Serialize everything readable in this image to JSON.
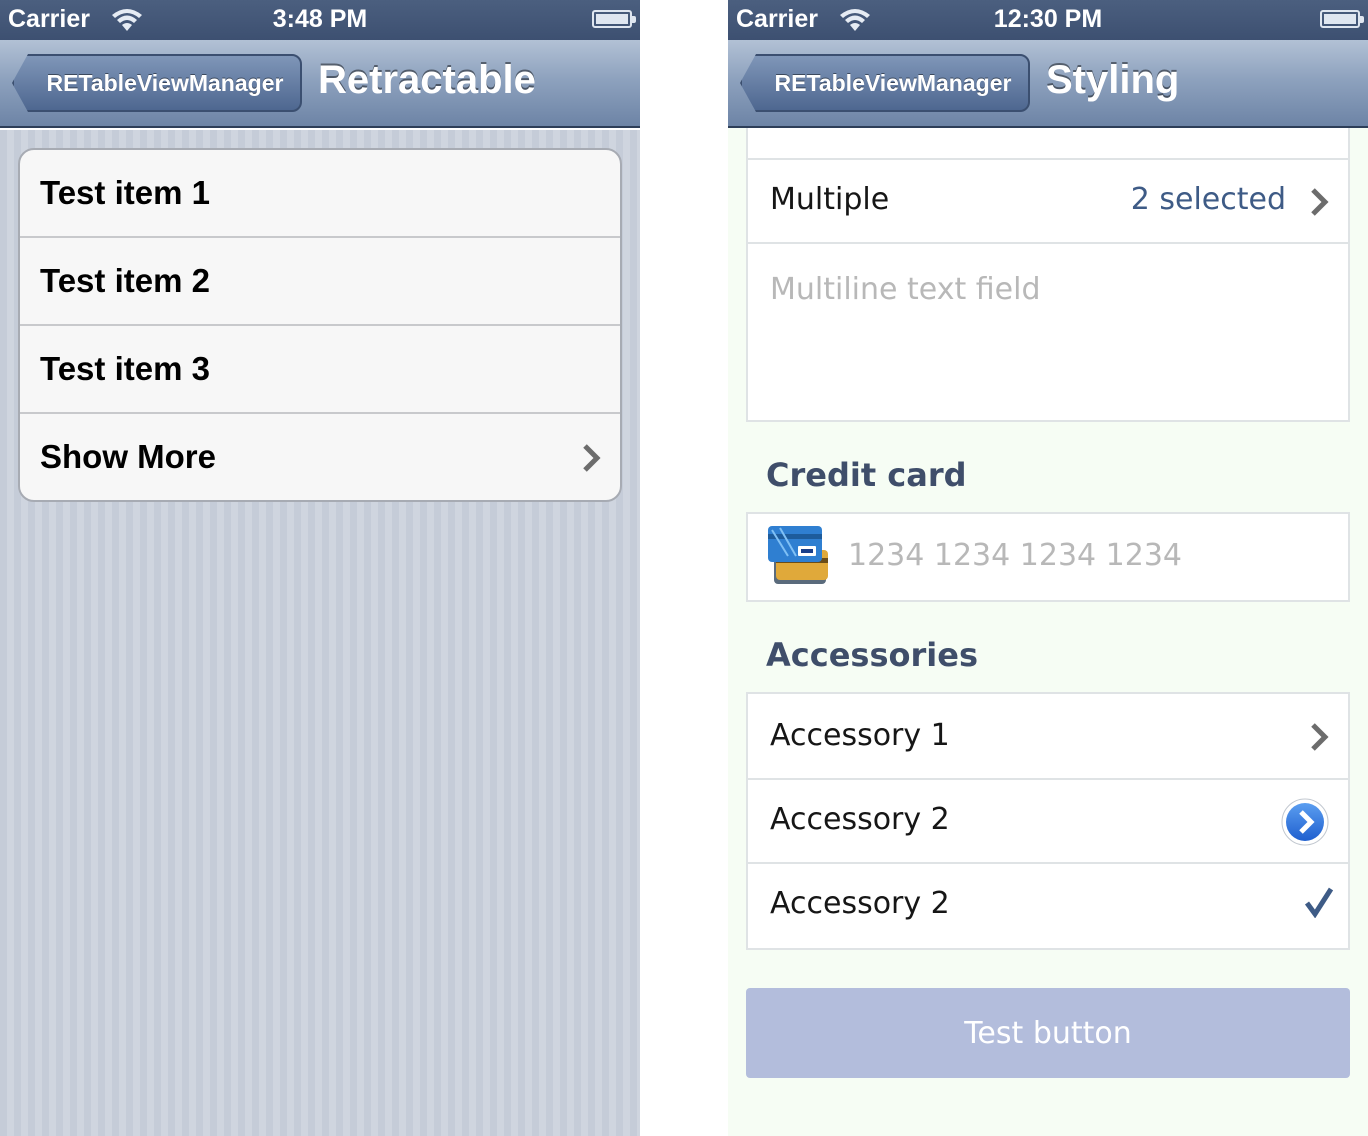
{
  "left": {
    "status": {
      "carrier": "Carrier",
      "time": "3:48 PM"
    },
    "nav": {
      "back_label": "RETableViewManager",
      "title": "Retractable"
    },
    "items": [
      "Test item 1",
      "Test item 2",
      "Test item 3"
    ],
    "show_more": "Show More"
  },
  "right": {
    "status": {
      "carrier": "Carrier",
      "time": "12:30 PM"
    },
    "nav": {
      "back_label": "RETableViewManager",
      "title": "Styling"
    },
    "multiple": {
      "label": "Multiple",
      "detail": "2 selected"
    },
    "multiline_placeholder": "Multiline text field",
    "credit_card": {
      "header": "Credit card",
      "placeholder": "1234 1234 1234 1234"
    },
    "accessories": {
      "header": "Accessories",
      "items": [
        "Accessory 1",
        "Accessory 2",
        "Accessory 2"
      ]
    },
    "button_label": "Test button"
  },
  "colors": {
    "nav_dark": "#3d5071",
    "detail_blue": "#3e5b86",
    "section_header": "#3f4e6a",
    "button_fill": "#b3bddc",
    "content_bg": "#f6fdf4"
  },
  "icons": [
    "wifi-icon",
    "battery-icon",
    "chevron-right-icon",
    "detail-disclosure-icon",
    "checkmark-icon",
    "credit-card-icon"
  ]
}
